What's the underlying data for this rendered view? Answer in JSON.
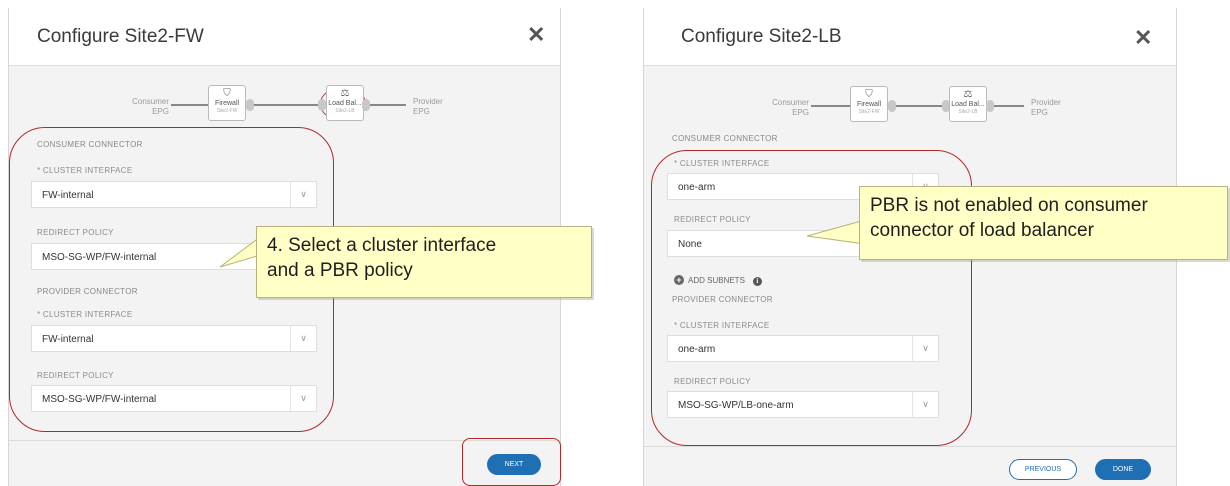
{
  "left_dialog": {
    "title": "Configure Site2-FW",
    "close_icon": "close-icon",
    "flow": {
      "consumer_label": "Consumer",
      "consumer_sub": "EPG",
      "node1_label": "Firewall",
      "node1_sub": "Site2-FW",
      "node2_label": "Load Bal...",
      "node2_sub": "Site2-LB",
      "provider_label": "Provider",
      "provider_sub": "EPG"
    },
    "consumer_connector": {
      "title": "CONSUMER CONNECTOR",
      "cluster_interface_label": "* CLUSTER INTERFACE",
      "cluster_interface_value": "FW-internal",
      "redirect_policy_label": "REDIRECT POLICY",
      "redirect_policy_value": "MSO-SG-WP/FW-internal"
    },
    "provider_connector": {
      "title": "PROVIDER CONNECTOR",
      "cluster_interface_label": "* CLUSTER INTERFACE",
      "cluster_interface_value": "FW-internal",
      "redirect_policy_label": "REDIRECT POLICY",
      "redirect_policy_value": "MSO-SG-WP/FW-internal"
    },
    "next_button": "NEXT"
  },
  "right_dialog": {
    "title": "Configure Site2-LB",
    "close_icon": "close-icon",
    "flow": {
      "consumer_label": "Consumer",
      "consumer_sub": "EPG",
      "node1_label": "Firewall",
      "node1_sub": "Site2-FW",
      "node2_label": "Load Bal...",
      "node2_sub": "Site2-LB",
      "provider_label": "Provider",
      "provider_sub": "EPG"
    },
    "consumer_connector": {
      "title": "CONSUMER CONNECTOR",
      "cluster_interface_label": "* CLUSTER INTERFACE",
      "cluster_interface_value": "one-arm",
      "redirect_policy_label": "REDIRECT POLICY",
      "redirect_policy_value": "None",
      "add_subnets": "ADD SUBNETS"
    },
    "provider_connector": {
      "title": "PROVIDER CONNECTOR",
      "cluster_interface_label": "* CLUSTER INTERFACE",
      "cluster_interface_value": "one-arm",
      "redirect_policy_label": "REDIRECT POLICY",
      "redirect_policy_value": "MSO-SG-WP/LB-one-arm"
    },
    "previous_button": "PREVIOUS",
    "done_button": "DONE"
  },
  "callouts": {
    "left_line1": "4. Select a cluster interface",
    "left_line2": "and a PBR policy",
    "right_line1": "PBR is not enabled on consumer",
    "right_line2": "connector of load balancer"
  },
  "colors": {
    "highlight_red": "#b0292a",
    "primary_blue": "#1f6fb5",
    "callout_yellow": "#ffffc6"
  }
}
